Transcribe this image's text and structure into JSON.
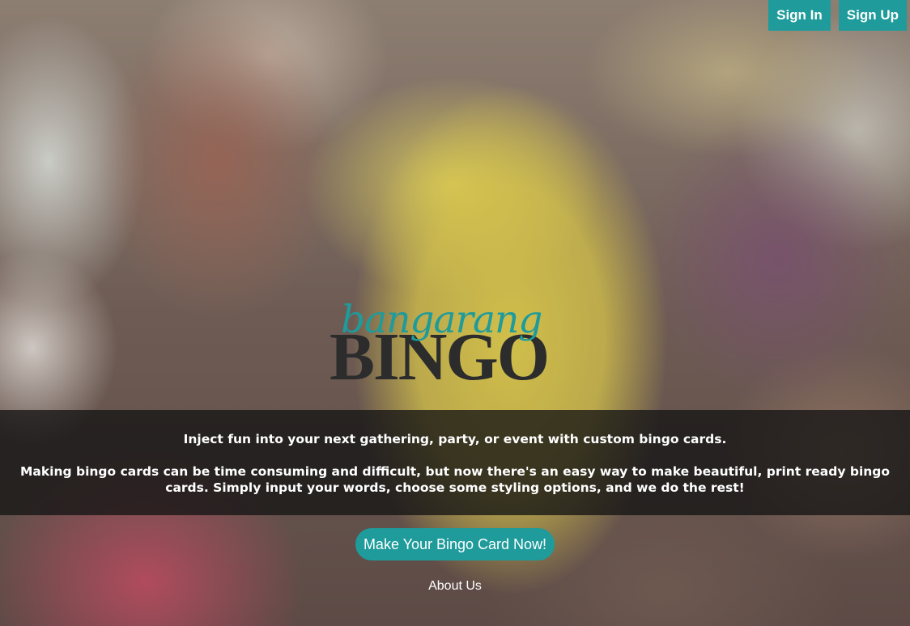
{
  "header": {
    "sign_in_label": "Sign In",
    "sign_up_label": "Sign Up"
  },
  "logo": {
    "script_text": "bangarang",
    "block_text": "BINGO"
  },
  "intro": {
    "line1": "Inject fun into your next gathering, party, or event with custom bingo cards.",
    "line2": "Making bingo cards can be time consuming and difficult, but now there's an easy way to make beautiful, print ready bingo cards. Simply input your words, choose some styling options, and we do the rest!"
  },
  "cta": {
    "label": "Make Your Bingo Card Now!"
  },
  "footer": {
    "about_label": "About Us"
  },
  "colors": {
    "accent": "#1e9b9a",
    "band": "#141414",
    "logo_dark": "#2c2c2c"
  }
}
